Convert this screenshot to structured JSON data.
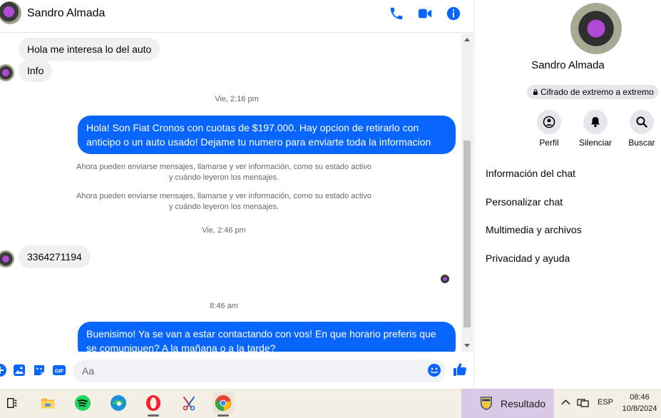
{
  "header": {
    "contact_name": "Sandro Almada",
    "icons": [
      "phone-icon",
      "video-camera-icon",
      "info-icon"
    ],
    "accent": "#0866ff"
  },
  "messages": {
    "incoming_1": "Hola me interesa lo del auto",
    "incoming_2": "Info",
    "timestamp_1": "Vie, 2:16 pm",
    "outgoing_1": "Hola! Son Fiat Cronos con cuotas de $197.000. Hay opcion de retirarlo con anticipo o un auto usado! Dejame tu numero para enviarte toda la informacion",
    "system_1_line1": "Ahora pueden enviarse mensajes, llamarse y ver información, como su estado activo",
    "system_1_line2": "y cuándo leyeron los mensajes.",
    "system_2_line1": "Ahora pueden enviarse mensajes, llamarse y ver información, como su estado activo",
    "system_2_line2": "y cuándo leyeron los mensajes.",
    "timestamp_2": "Vie, 2:46 pm",
    "incoming_3": "3364271194",
    "timestamp_3": "8:46 am",
    "outgoing_2": "Buenisimo! Ya se van a estar contactando con vos! En que horario preferis que se comuniquen? A la mañana o a la tarde?"
  },
  "composer": {
    "placeholder": "Aa",
    "icons": [
      "plus-circle-icon",
      "photo-icon",
      "sticker-icon",
      "gif-icon",
      "emoji-icon",
      "thumbs-up-icon"
    ],
    "gif_label": "GIF"
  },
  "details_panel": {
    "name": "Sandro Almada",
    "encryption": "Cifrado de extremo a extremo",
    "actions": [
      {
        "label": "Perfil",
        "icon": "profile-icon"
      },
      {
        "label": "Silenciar",
        "icon": "bell-icon"
      },
      {
        "label": "Buscar",
        "icon": "search-icon"
      }
    ],
    "menu": [
      "Información del chat",
      "Personalizar chat",
      "Multimedia y archivos",
      "Privacidad y ayuda"
    ]
  },
  "taskbar": {
    "apps": [
      "task-view-icon",
      "file-explorer-icon",
      "spotify-icon",
      "edge-icon",
      "opera-icon",
      "snipping-tool-icon",
      "chrome-icon"
    ],
    "widget_label": "Resultado",
    "language": "ESP",
    "time": "08:46",
    "date": "10/8/2024"
  }
}
